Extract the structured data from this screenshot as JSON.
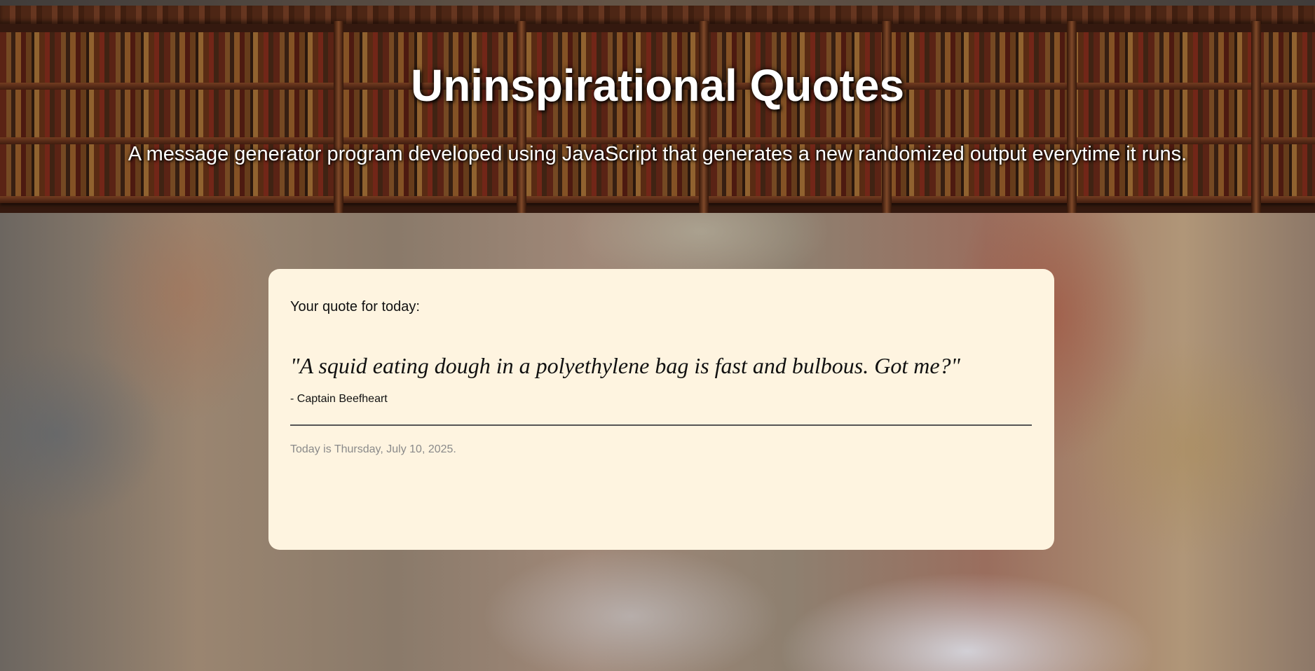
{
  "header": {
    "title": "Uninspirational Quotes",
    "subtitle": "A message generator program developed using JavaScript that generates a new randomized output everytime it runs."
  },
  "card": {
    "heading": "Your quote for today:",
    "quote": "\"A squid eating dough in a polyethylene bag is fast and bulbous. Got me?\"",
    "author": "- Captain Beefheart",
    "date": "Today is Thursday, July 10, 2025."
  },
  "colors": {
    "card_background": "#fef4e0",
    "title_text": "#ffffff",
    "date_text": "#8a8a8a",
    "divider": "#555555"
  }
}
